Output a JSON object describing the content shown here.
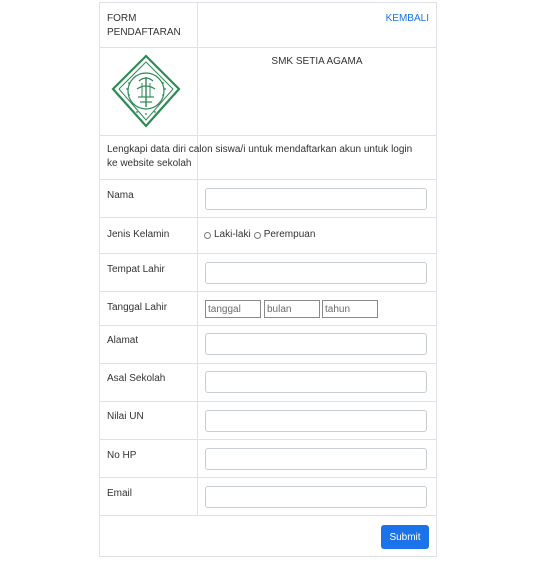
{
  "header": {
    "title": "FORM\nPENDAFTARAN",
    "back_link": "KEMBALI"
  },
  "school": {
    "name": "SMK SETIA AGAMA",
    "logo_icon": "school-emblem-icon",
    "logo_color": "#2e8b57"
  },
  "intro_text": "Lengkapi data diri calon siswa/i untuk mendaftarkan akun untuk login ke website sekolah",
  "fields": {
    "nama": {
      "label": "Nama",
      "value": ""
    },
    "jenis_kelamin": {
      "label": "Jenis Kelamin",
      "options": [
        "Laki-laki",
        "Perempuan"
      ]
    },
    "tempat_lahir": {
      "label": "Tempat Lahir",
      "value": ""
    },
    "tanggal_lahir": {
      "label": "Tanggal Lahir",
      "placeholders": {
        "day": "tanggal",
        "month": "bulan",
        "year": "tahun"
      }
    },
    "alamat": {
      "label": "Alamat",
      "value": ""
    },
    "asal_sekolah": {
      "label": "Asal Sekolah",
      "value": ""
    },
    "nilai_un": {
      "label": "Nilai UN",
      "value": ""
    },
    "no_hp": {
      "label": "No HP",
      "value": ""
    },
    "email": {
      "label": "Email",
      "value": ""
    }
  },
  "submit_label": "Submit",
  "colors": {
    "accent": "#1a73e8",
    "border": "#dee2e6",
    "text": "#333333"
  }
}
